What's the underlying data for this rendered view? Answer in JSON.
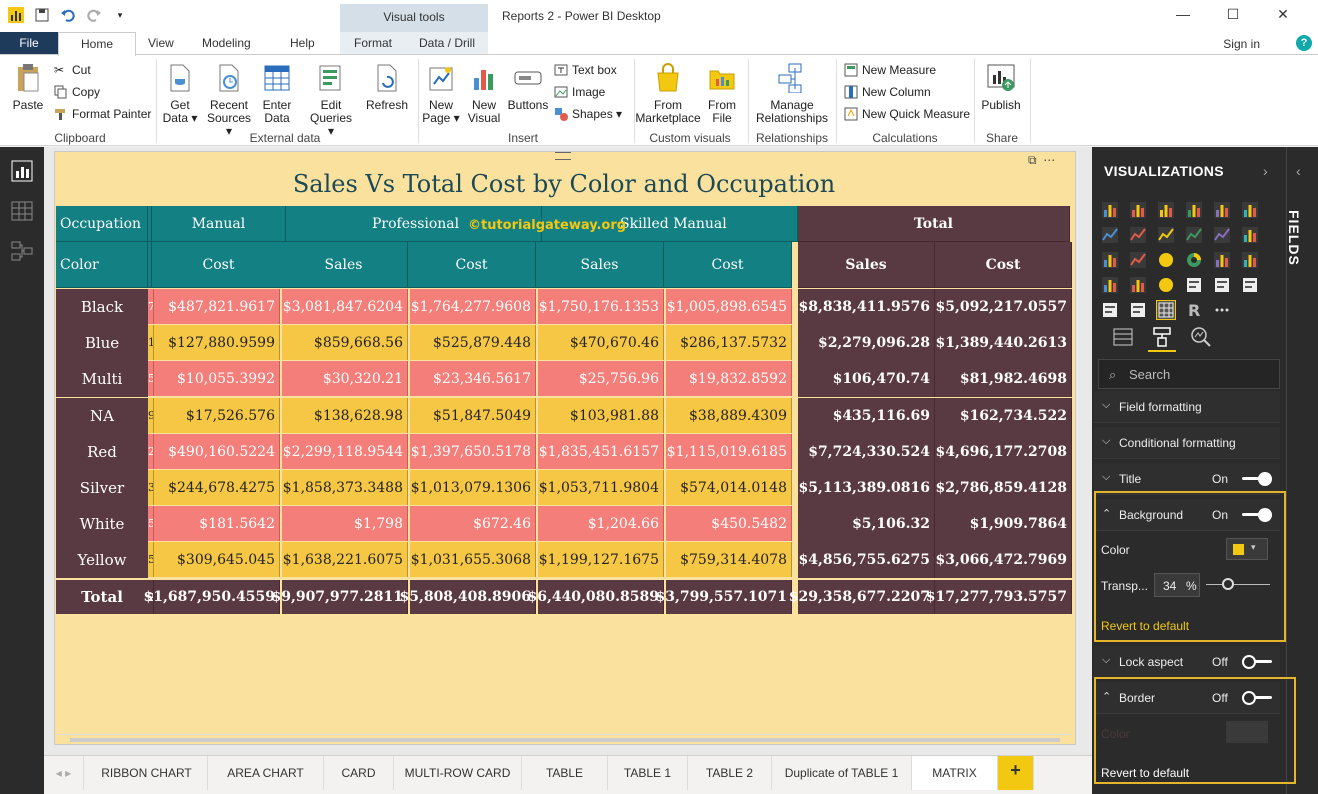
{
  "titlebar": {
    "app_title": "Reports 2 - Power BI Desktop",
    "context_tools": "Visual tools"
  },
  "tabs": {
    "file": "File",
    "home": "Home",
    "view": "View",
    "modeling": "Modeling",
    "help": "Help",
    "format": "Format",
    "data_drill": "Data / Drill",
    "sign_in": "Sign in"
  },
  "ribbon": {
    "clipboard": {
      "paste": "Paste",
      "cut": "Cut",
      "copy": "Copy",
      "format_painter": "Format Painter",
      "label": "Clipboard"
    },
    "external_data": {
      "get_data": [
        "Get",
        "Data ▾"
      ],
      "recent_sources": [
        "Recent",
        "Sources ▾"
      ],
      "enter_data": [
        "Enter",
        "Data"
      ],
      "edit_queries": [
        "Edit",
        "Queries ▾"
      ],
      "refresh": "Refresh",
      "label": "External data"
    },
    "insert": {
      "new_page": [
        "New",
        "Page ▾"
      ],
      "new_visual": [
        "New",
        "Visual"
      ],
      "buttons": "Buttons",
      "text_box": "Text box",
      "image": "Image",
      "shapes": "Shapes ▾",
      "label": "Insert"
    },
    "custom_visuals": {
      "from_marketplace": [
        "From",
        "Marketplace"
      ],
      "from_file": [
        "From",
        "File"
      ],
      "label": "Custom visuals"
    },
    "relationships": {
      "manage": [
        "Manage",
        "Relationships"
      ],
      "label": "Relationships"
    },
    "calculations": {
      "new_measure": "New Measure",
      "new_column": "New Column",
      "new_quick_measure": "New Quick Measure",
      "label": "Calculations"
    },
    "share": {
      "publish": "Publish",
      "label": "Share"
    }
  },
  "visual": {
    "title": "Sales Vs Total Cost by Color and Occupation",
    "watermark": "©tutorialgateway.org",
    "header_row1": {
      "occupation": "Occupation",
      "manual": "Manual",
      "professional": "Professional",
      "skilled_manual": "Skilled Manual",
      "total": "Total"
    },
    "header_row2": {
      "color": "Color",
      "cols": [
        "Cost",
        "Sales",
        "Cost",
        "Sales",
        "Cost"
      ],
      "total_cols": [
        "Sales",
        "Cost"
      ]
    },
    "rows": [
      {
        "label": "Black",
        "gutter": "7",
        "values": [
          "$487,821.9617",
          "$3,081,847.6204",
          "$1,764,277.9608",
          "$1,750,176.1353",
          "$1,005,898.6545"
        ],
        "totals": [
          "$8,838,411.9576",
          "$5,092,217.0557"
        ]
      },
      {
        "label": "Blue",
        "gutter": "1",
        "values": [
          "$127,880.9599",
          "$859,668.56",
          "$525,879.448",
          "$470,670.46",
          "$286,137.5732"
        ],
        "totals": [
          "$2,279,096.28",
          "$1,389,440.2613"
        ]
      },
      {
        "label": "Multi",
        "gutter": "5",
        "values": [
          "$10,055.3992",
          "$30,320.21",
          "$23,346.5617",
          "$25,756.96",
          "$19,832.8592"
        ],
        "totals": [
          "$106,470.74",
          "$81,982.4698"
        ]
      },
      {
        "label": "NA",
        "gutter": "9",
        "values": [
          "$17,526.576",
          "$138,628.98",
          "$51,847.5049",
          "$103,981.88",
          "$38,889.4309"
        ],
        "totals": [
          "$435,116.69",
          "$162,734.522"
        ]
      },
      {
        "label": "Red",
        "gutter": "2",
        "values": [
          "$490,160.5224",
          "$2,299,118.9544",
          "$1,397,650.5178",
          "$1,835,451.6157",
          "$1,115,019.6185"
        ],
        "totals": [
          "$7,724,330.524",
          "$4,696,177.2708"
        ]
      },
      {
        "label": "Silver",
        "gutter": "3",
        "values": [
          "$244,678.4275",
          "$1,858,373.3488",
          "$1,013,079.1306",
          "$1,053,711.9804",
          "$574,014.0148"
        ],
        "totals": [
          "$5,113,389.0816",
          "$2,786,859.4128"
        ]
      },
      {
        "label": "White",
        "gutter": "5",
        "values": [
          "$181.5642",
          "$1,798",
          "$672.46",
          "$1,204.66",
          "$450.5482"
        ],
        "totals": [
          "$5,106.32",
          "$1,909.7864"
        ]
      },
      {
        "label": "Yellow",
        "gutter": "5",
        "values": [
          "$309,645.045",
          "$1,638,221.6075",
          "$1,031,655.3068",
          "$1,199,127.1675",
          "$759,314.4078"
        ],
        "totals": [
          "$4,856,755.6275",
          "$3,066,472.7969"
        ]
      }
    ],
    "total_row": {
      "label": "Total",
      "gutter": "2",
      "values": [
        "$1,687,950.4559",
        "$9,907,977.2811",
        "$5,808,408.8906",
        "$6,440,080.8589",
        "$3,799,557.1071"
      ],
      "totals": [
        "$29,358,677.2207",
        "$17,277,793.5757"
      ]
    }
  },
  "page_tabs": [
    "RIBBON CHART",
    "AREA CHART",
    "CARD",
    "MULTI-ROW CARD",
    "TABLE",
    "TABLE 1",
    "TABLE 2",
    "Duplicate of TABLE 1",
    "MATRIX"
  ],
  "page_tab_add": "+",
  "panel": {
    "title": "VISUALIZATIONS",
    "fields_label": "FIELDS",
    "search_placeholder": "Search",
    "sections": {
      "field_formatting": "Field formatting",
      "conditional_formatting": "Conditional formatting",
      "title": {
        "name": "Title",
        "state": "On"
      },
      "background": {
        "name": "Background",
        "state": "On"
      },
      "lock_aspect": {
        "name": "Lock aspect",
        "state": "Off"
      },
      "border": {
        "name": "Border",
        "state": "Off"
      }
    },
    "background_color_label": "Color",
    "background_color": "#f2c811",
    "transparency_label": "Transp...",
    "transparency_value": "34",
    "transparency_unit": "%",
    "transparency_level": 0.34,
    "border_color_label": "Color",
    "revert_default": "Revert to default"
  },
  "colors": {
    "header_teal": "#138083",
    "total_maroon": "#5a3a42",
    "cell_pink": "#f47f7a",
    "cell_yellow": "#f6c744",
    "page_background": "#fae19e",
    "accent_yellow": "#f2c811"
  }
}
